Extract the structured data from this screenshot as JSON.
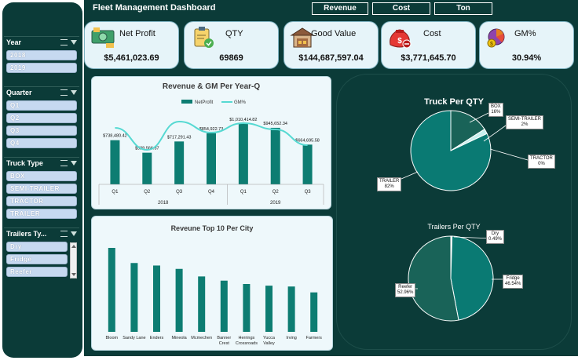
{
  "header": {
    "title": "Fleet Management Dashboard",
    "buttons": [
      "Revenue",
      "Cost",
      "Ton"
    ]
  },
  "slicers": {
    "year": {
      "title": "Year",
      "items": [
        "2018",
        "2019"
      ]
    },
    "quarter": {
      "title": "Quarter",
      "items": [
        "Q1",
        "Q2",
        "Q3",
        "Q4"
      ]
    },
    "truck_type": {
      "title": "Truck Type",
      "items": [
        "BOX",
        "SEMI-TRAILER",
        "TRACTOR",
        "TRAILER"
      ]
    },
    "trailers_type": {
      "title": "Trailers Ty...",
      "items": [
        "Dry",
        "Fridge",
        "Reefer"
      ]
    }
  },
  "kpis": [
    {
      "label": "Net Profit",
      "value": "$5,461,023.69",
      "icon": "money-icon"
    },
    {
      "label": "QTY",
      "value": "69869",
      "icon": "clipboard-check-icon"
    },
    {
      "label": "Good Value",
      "value": "$144,687,597.04",
      "icon": "warehouse-icon"
    },
    {
      "label": "Cost",
      "value": "$3,771,645.70",
      "icon": "money-bag-icon"
    },
    {
      "label": "GM%",
      "value": "30.94%",
      "icon": "coins-icon"
    }
  ],
  "colors": {
    "dark": "#0b3b38",
    "bar": "#0d7d72",
    "line": "#56d9d2",
    "pie_main": "#0a7a73",
    "pie_second": "#196358",
    "pie_light": "#c8f0ee"
  },
  "chart_data": [
    {
      "type": "bar",
      "title": "Revenue & GM Per Year-Q",
      "categories": [
        "Q1",
        "Q2",
        "Q3",
        "Q4",
        "Q1",
        "Q2",
        "Q3"
      ],
      "groups": [
        {
          "label": "2018",
          "count": 4
        },
        {
          "label": "2019",
          "count": 3
        }
      ],
      "series": [
        {
          "name": "NetProfit",
          "type": "bar",
          "values": [
            738480.42,
            529566.37,
            717291.43,
            854922.73,
            1010414.82,
            945652.34,
            664695.58
          ]
        },
        {
          "name": "GM%",
          "type": "line",
          "values": [
            0.36,
            0.22,
            0.4,
            0.33,
            0.39,
            0.35,
            0.25
          ]
        }
      ],
      "data_labels": [
        "$738,480.42",
        "$529,566.37",
        "$717,291.43",
        "$854,922.73",
        "$1,010,414.82",
        "$945,652.34",
        "$664,695.58"
      ],
      "legend": "top-center"
    },
    {
      "type": "bar",
      "title": "Reveune Top 10 Per City",
      "categories": [
        "Bloom",
        "Sandy Lane",
        "Enders",
        "Mineola",
        "Mcmechen",
        "Banner Crest",
        "Herrings Crossroads",
        "Yucca Valley",
        "Irving",
        "Farmers"
      ],
      "values": [
        100,
        82,
        79,
        75,
        66,
        61,
        57,
        55,
        54,
        47
      ]
    },
    {
      "type": "pie",
      "title": "Truck Per QTY",
      "labels": [
        "BOX",
        "SEMI-TRAILER",
        "TRACTOR",
        "TRAILER"
      ],
      "values": [
        16,
        2,
        0,
        82
      ],
      "value_labels": [
        "16%",
        "2%",
        "0%",
        "82%"
      ]
    },
    {
      "type": "pie",
      "title": "Trailers Per QTY",
      "labels": [
        "Dry",
        "Fridge",
        "Reefer"
      ],
      "values": [
        0.49,
        46.54,
        52.96
      ],
      "value_labels": [
        "0.49%",
        "46.54%",
        "52.96%"
      ]
    }
  ]
}
